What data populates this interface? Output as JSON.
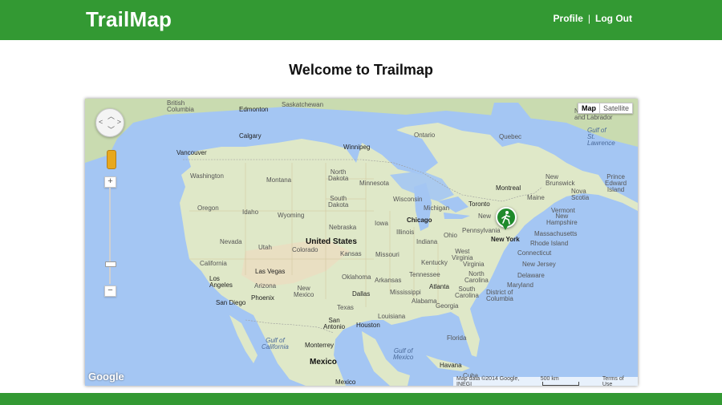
{
  "header": {
    "brand": "TrailMap",
    "profile_link": "Profile",
    "separator": "|",
    "logout_link": "Log Out",
    "bar_color": "#339933"
  },
  "main": {
    "title": "Welcome to Trailmap"
  },
  "map": {
    "type_buttons": {
      "map": "Map",
      "satellite": "Satellite",
      "selected": "Map"
    },
    "zoom_in": "+",
    "zoom_out": "−",
    "google_logo": "Google",
    "attribution": "Map data ©2014 Google, INEGI",
    "scale": "500 km",
    "terms": "Terms of Use",
    "marker_icon": "hiker-icon",
    "labels": {
      "british_columbia": "British\nColumbia",
      "edmonton": "Edmonton",
      "saskatchewan": "Saskatchewan",
      "calgary": "Calgary",
      "winnipeg": "Winnipeg",
      "ontario": "Ontario",
      "quebec": "Quebec",
      "newfoundland": "Newfoundland\nand Labrador",
      "vancouver": "Vancouver",
      "washington": "Washington",
      "montana": "Montana",
      "north_dakota": "North\nDakota",
      "minnesota": "Minnesota",
      "oregon": "Oregon",
      "idaho": "Idaho",
      "wyoming": "Wyoming",
      "south_dakota": "South\nDakota",
      "wisconsin": "Wisconsin",
      "michigan": "Michigan",
      "toronto": "Toronto",
      "montreal": "Montreal",
      "maine": "Maine",
      "new_brunswick": "New\nBrunswick",
      "nova_scotia": "Nova\nScotia",
      "prince_edward": "Prince\nEdward\nIsland",
      "gulf_st_lawrence": "Gulf of\nSt.\nLawrence",
      "vermont": "Vermont",
      "new_hampshire": "New\nHampshire",
      "massachusetts": "Massachusetts",
      "rhode_island": "Rhode Island",
      "connecticut": "Connecticut",
      "new_jersey": "New Jersey",
      "delaware": "Delaware",
      "maryland": "Maryland",
      "district_columbia": "District of\nColumbia",
      "nevada": "Nevada",
      "utah": "Utah",
      "united_states": "United States",
      "colorado": "Colorado",
      "nebraska": "Nebraska",
      "iowa": "Iowa",
      "chicago": "Chicago",
      "illinois": "Illinois",
      "indiana": "Indiana",
      "ohio": "Ohio",
      "pennsylvania": "Pennsylvania",
      "new_york_state": "New",
      "new_york_city": "New York",
      "california": "California",
      "kansas": "Kansas",
      "missouri": "Missouri",
      "kentucky": "Kentucky",
      "west_virginia": "West\nVirginia",
      "virginia": "Virginia",
      "las_vegas": "Las Vegas",
      "los_angeles": "Los\nAngeles",
      "arizona": "Arizona",
      "new_mexico": "New\nMexico",
      "oklahoma": "Oklahoma",
      "arkansas": "Arkansas",
      "tennessee": "Tennessee",
      "north_carolina": "North\nCarolina",
      "south_carolina": "South\nCarolina",
      "san_diego": "San Diego",
      "phoenix": "Phoenix",
      "dallas": "Dallas",
      "mississippi": "Mississippi",
      "atlanta": "Atlanta",
      "alabama": "Alabama",
      "georgia": "Georgia",
      "texas": "Texas",
      "louisiana": "Louisiana",
      "san_antonio": "San\nAntonio",
      "houston": "Houston",
      "gulf_california": "Gulf of\nCalifornia",
      "gulf_mexico": "Gulf of\nMexico",
      "florida": "Florida",
      "monterrey": "Monterrey",
      "mexico": "Mexico",
      "havana": "Havana",
      "cuba": "Cuba",
      "mexico_city": "Mexico"
    }
  }
}
